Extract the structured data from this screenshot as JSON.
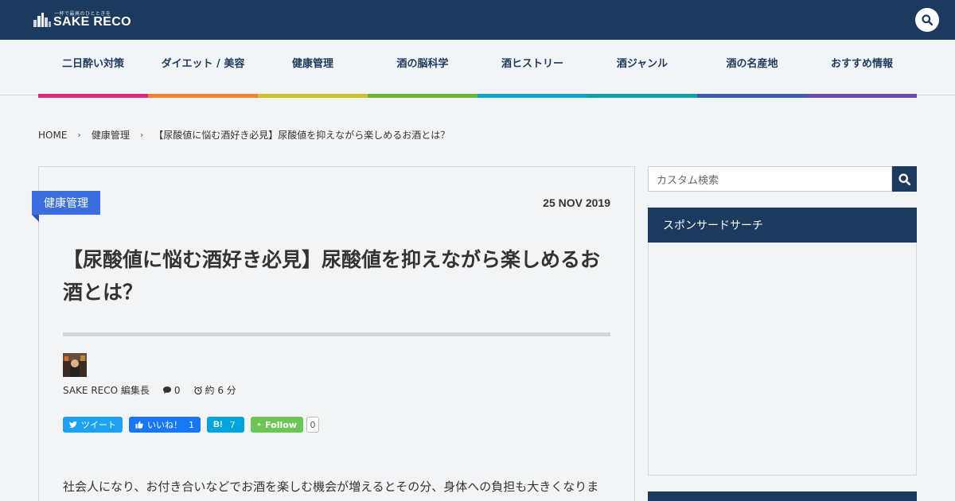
{
  "header": {
    "logo_tagline": "一杯で最高のひとときを",
    "logo_text": "SAKE RECO"
  },
  "nav": {
    "items": [
      {
        "label": "二日酔い対策",
        "color": "#e0287a"
      },
      {
        "label": "ダイエット / 美容",
        "color": "#ee8236"
      },
      {
        "label": "健康管理",
        "color": "#cfc030"
      },
      {
        "label": "酒の脳科学",
        "color": "#6ab43a"
      },
      {
        "label": "酒ヒストリー",
        "color": "#0fa6c9"
      },
      {
        "label": "酒ジャンル",
        "color": "#12a0a8"
      },
      {
        "label": "酒の名産地",
        "color": "#3b5ea6"
      },
      {
        "label": "おすすめ情報",
        "color": "#6b4ea8"
      }
    ]
  },
  "breadcrumb": {
    "home": "HOME",
    "category": "健康管理",
    "current": "【尿酸値に悩む酒好き必見】尿酸値を抑えながら楽しめるお酒とは？"
  },
  "article": {
    "category": "健康管理",
    "date": "25 NOV 2019",
    "title": "【尿酸値に悩む酒好き必見】尿酸値を抑えながら楽しめるお酒とは？",
    "author": "SAKE RECO 編集長",
    "comments": "0",
    "read_time": "約 6 分",
    "body_start": "社会人になり、お付き合いなどでお酒を楽しむ機会が増えるとその分、身体への負担も大きくなりま"
  },
  "share": {
    "tweet_label": "ツイート",
    "like_label": "いいね！",
    "like_count": "1",
    "hatena_label": "B!",
    "hatena_count": "7",
    "follow_label": "Follow",
    "follow_count": "0"
  },
  "sidebar": {
    "search_placeholder": "カスタム検索",
    "widget_title": "スポンサードサーチ"
  }
}
